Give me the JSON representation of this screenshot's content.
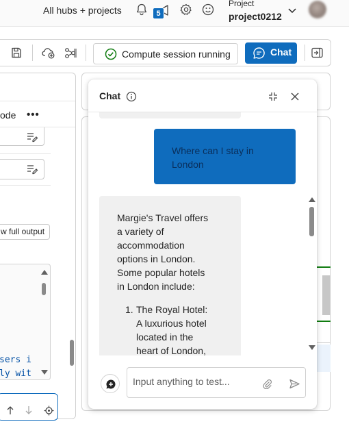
{
  "header": {
    "hubs_label": "All hubs + projects",
    "notification_badge": "5",
    "project_label": "Project",
    "project_name": "project0212"
  },
  "toolbar": {
    "compute_status": "Compute session running",
    "chat_label": "Chat"
  },
  "left_panel": {
    "mode_text": "ode",
    "more_label": "•••",
    "full_output_label": "w full output",
    "code_lines": [
      "sers i",
      "ly wit"
    ]
  },
  "chat": {
    "title": "Chat",
    "user_message": "Where can I stay in London",
    "assistant_message_intro": "Margie's Travel offers a variety of accommodation options in London. Some popular hotels in London include:",
    "assistant_list": [
      {
        "number": "1.",
        "text": "The Royal Hotel: A luxurious hotel located in the heart of London,"
      }
    ],
    "input_placeholder": "Input anything to test..."
  },
  "colors": {
    "accent": "#0f6cbd",
    "success": "#107c10",
    "bubble_assistant": "#f0f0f0"
  },
  "icons": [
    "bell-icon",
    "megaphone-icon",
    "gear-icon",
    "smiley-icon",
    "chevron-down-icon",
    "save-icon",
    "cloud-sync-icon",
    "flow-icon",
    "check-circle-icon",
    "chat-bubble-icon",
    "collapse-panel-icon",
    "info-icon",
    "minimize-icon",
    "close-icon",
    "new-chat-icon",
    "attach-icon",
    "send-icon",
    "edit-lines-icon",
    "arrow-up-icon",
    "arrow-down-icon",
    "target-icon"
  ]
}
